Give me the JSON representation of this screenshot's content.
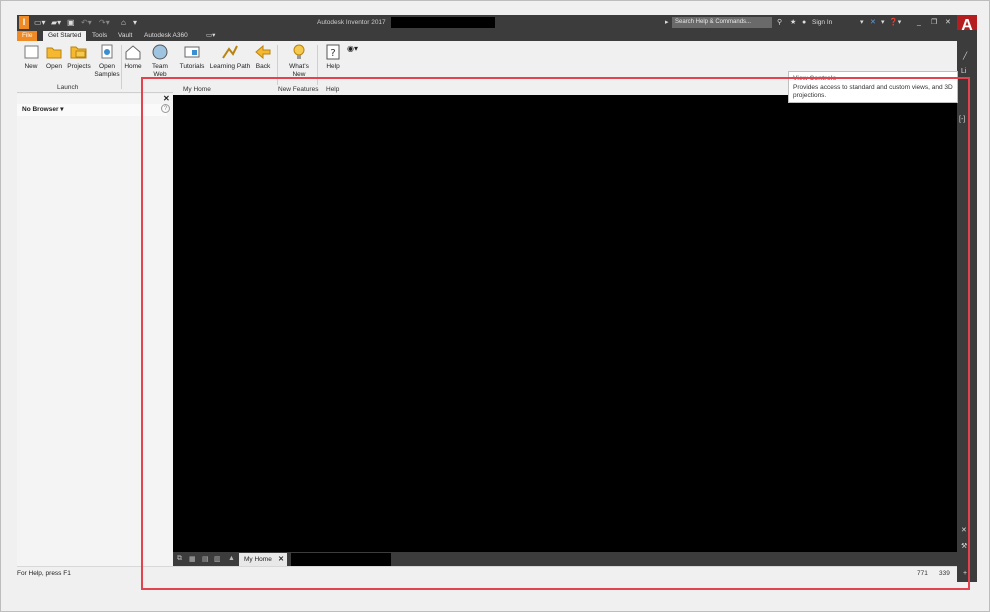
{
  "window": {
    "title": "Autodesk Inventor 2017",
    "search_placeholder": "Search Help & Commands...",
    "sign_in": "Sign In",
    "logo_letter": "I",
    "autodesk_letter": "A"
  },
  "ribbon_tabs": [
    {
      "label": "File"
    },
    {
      "label": "Get Started"
    },
    {
      "label": "Tools"
    },
    {
      "label": "Vault"
    },
    {
      "label": "Autodesk A360"
    }
  ],
  "ribbon": {
    "launch_label": "Launch",
    "buttons": {
      "new": "New",
      "open": "Open",
      "projects": "Projects",
      "open_samples": "Open Samples",
      "home": "Home",
      "team_web": "Team Web",
      "tutorials": "Tutorials",
      "learning_path": "Learning Path",
      "back": "Back",
      "whats_new": "What's New",
      "help": "Help"
    }
  },
  "home_tabs": {
    "my_home": "My Home",
    "new_features": "New Features",
    "help": "Help"
  },
  "browser": {
    "header": "No Browser ▾"
  },
  "tooltip": {
    "title": "View Controls",
    "body": "Provides access to standard and custom views, and 3D projections."
  },
  "doc_tabs": {
    "home": "My Home"
  },
  "status": {
    "text": "For Help, press F1",
    "coord_x": "771",
    "coord_y": "339"
  },
  "colors": {
    "accent": "#f08a24",
    "highlight": "#e3434f",
    "chrome": "#3c3c3c"
  }
}
